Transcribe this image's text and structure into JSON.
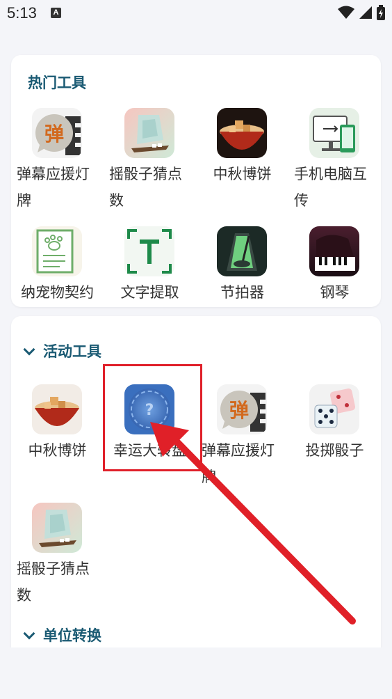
{
  "status_bar": {
    "time": "5:13",
    "notif_letter": "A"
  },
  "hot_tools": {
    "title": "热门工具",
    "items": [
      {
        "label": "弹幕应援灯牌",
        "icon": "barrage-icon"
      },
      {
        "label": "摇骰子猜点数",
        "icon": "dice-cup-icon"
      },
      {
        "label": "中秋博饼",
        "icon": "mooncake-bowl-icon"
      },
      {
        "label": "手机电脑互传",
        "icon": "phone-pc-transfer-icon"
      },
      {
        "label": "纳宠物契约",
        "icon": "pet-contract-icon"
      },
      {
        "label": "文字提取",
        "icon": "text-extract-icon"
      },
      {
        "label": "节拍器",
        "icon": "metronome-icon"
      },
      {
        "label": "钢琴",
        "icon": "piano-icon"
      }
    ]
  },
  "activity_tools": {
    "title": "活动工具",
    "items": [
      {
        "label": "中秋博饼",
        "icon": "mooncake-bowl-icon"
      },
      {
        "label": "幸运大转盘",
        "icon": "lucky-wheel-icon"
      },
      {
        "label": "弹幕应援灯牌",
        "icon": "barrage-icon"
      },
      {
        "label": "投掷骰子",
        "icon": "dice-icon"
      },
      {
        "label": "摇骰子猜点数",
        "icon": "dice-cup-icon"
      }
    ]
  },
  "unit_convert": {
    "title": "单位转换"
  },
  "colors": {
    "section_title": "#1a5a73",
    "highlight": "#e0202a",
    "background": "#f4f5f9"
  }
}
